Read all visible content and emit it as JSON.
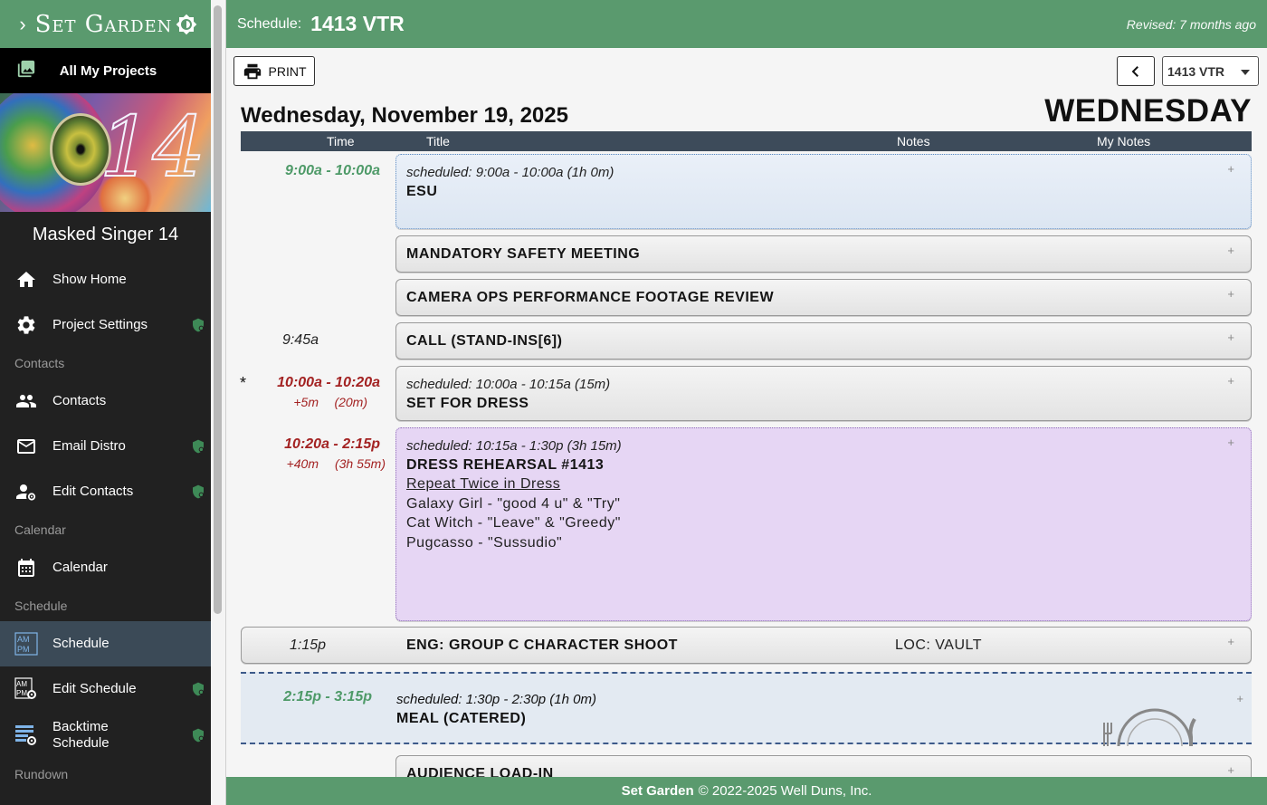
{
  "app": {
    "brand": "Set Garden"
  },
  "sidebar": {
    "all_projects": "All My Projects",
    "art_number": "14",
    "project_title": "Masked Singer 14",
    "items": {
      "show_home": "Show Home",
      "project_settings": "Project Settings",
      "contacts_section": "Contacts",
      "contacts": "Contacts",
      "email_distro": "Email Distro",
      "edit_contacts": "Edit Contacts",
      "calendar_section": "Calendar",
      "calendar": "Calendar",
      "schedule_section": "Schedule",
      "schedule": "Schedule",
      "edit_schedule": "Edit Schedule",
      "backtime_1": "Backtime",
      "backtime_2": "Schedule",
      "rundown_section": "Rundown"
    }
  },
  "header": {
    "label": "Schedule:",
    "value": "1413 VTR",
    "revised": "Revised: 7 months ago"
  },
  "toolbar": {
    "print": "PRINT",
    "schedule_select": "1413 VTR"
  },
  "page": {
    "date": "Wednesday, November 19, 2025",
    "day": "WEDNESDAY"
  },
  "columns": {
    "time": "Time",
    "title": "Title",
    "notes": "Notes",
    "my_notes": "My Notes"
  },
  "rows": {
    "esu": {
      "time": "9:00a - 10:00a",
      "scheduled": "scheduled: 9:00a - 10:00a (1h 0m)",
      "title": "ESU",
      "plus": "+"
    },
    "safety": {
      "title": "MANDATORY SAFETY MEETING",
      "plus": "+"
    },
    "camera": {
      "title": "CAMERA OPS PERFORMANCE FOOTAGE REVIEW",
      "plus": "+"
    },
    "call": {
      "time": "9:45a",
      "title": "CALL (STAND-INS[6])",
      "plus": "+"
    },
    "set": {
      "star": "*",
      "time": "10:00a - 10:20a",
      "offset": "+5m",
      "duration": "(20m)",
      "scheduled": "scheduled: 10:00a - 10:15a (15m)",
      "title": "SET FOR DRESS",
      "plus": "+"
    },
    "dress": {
      "time": "10:20a - 2:15p",
      "offset": "+40m",
      "duration": "(3h 55m)",
      "scheduled": "scheduled: 10:15a - 1:30p (3h 15m)",
      "title": "DRESS REHEARSAL #1413",
      "lines": [
        "Repeat Twice in Dress",
        "Galaxy Girl - \"good 4 u\" & \"Try\"",
        "Cat Witch - \"Leave\" & \"Greedy\"",
        "Pugcasso - \"Sussudio\""
      ],
      "plus": "+"
    },
    "eng": {
      "time": "1:15p",
      "title": "ENG: GROUP C CHARACTER SHOOT",
      "notes": "LOC: VAULT",
      "plus": "+"
    },
    "meal": {
      "time": "2:15p - 3:15p",
      "scheduled": "scheduled: 1:30p - 2:30p (1h 0m)",
      "title": "MEAL (CATERED)",
      "plus": "+"
    },
    "audience": {
      "title": "AUDIENCE LOAD-IN",
      "plus": "+"
    }
  },
  "footer": {
    "brand": "Set Garden",
    "copyright": "© 2022-2025 Well Duns, Inc."
  },
  "colors": {
    "green": "#5a9a6e",
    "sidebar": "#212121",
    "header_row": "#3d4b5a",
    "time_green": "#4e9a68",
    "time_red": "#a32222",
    "dress_bg": "#e6d6f4",
    "esu_bg": "#eaf0f8"
  },
  "icons": [
    "chevron-right-icon",
    "theme-icon",
    "projects-icon",
    "home-icon",
    "gear-icon",
    "people-icon",
    "mail-icon",
    "edit-contacts-icon",
    "calendar-icon",
    "schedule-icon",
    "edit-schedule-icon",
    "backtime-icon",
    "shield-icon",
    "printer-icon",
    "chevron-left-icon",
    "plate-icon"
  ]
}
